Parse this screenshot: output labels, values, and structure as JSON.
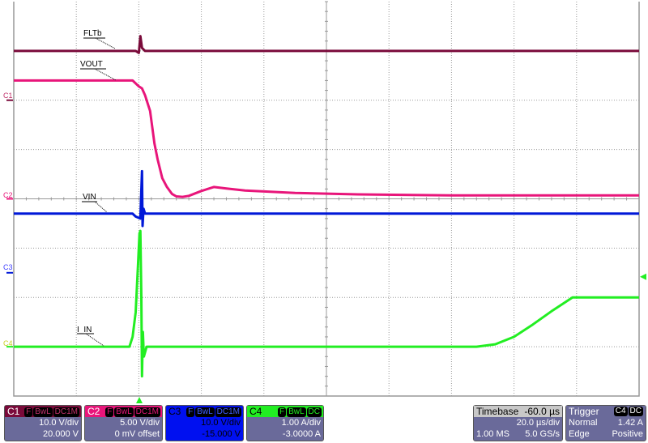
{
  "chart_data": {
    "type": "line",
    "title": "",
    "xlabel": "",
    "ylabel": "",
    "x_units": "µs",
    "xlim": [
      -40,
      160
    ],
    "grid": true,
    "divisions": {
      "horizontal": 10,
      "vertical": 8
    },
    "trace_labels": {
      "fltb": "FLTb",
      "vout": "VOUT",
      "vin": "VIN",
      "iin": "I_IN"
    },
    "series": [
      {
        "channel": "C1",
        "name": "FLTb",
        "color": "#7a0a3a",
        "scale_per_div": 10,
        "offset": 20,
        "x": [
          -40,
          -1,
          0,
          0.5,
          1,
          2,
          160
        ],
        "y": [
          10,
          10,
          9.6,
          13,
          10.6,
          10,
          10
        ]
      },
      {
        "channel": "C2",
        "name": "VOUT",
        "color": "#e8157a",
        "scale_per_div": 5,
        "offset": 0,
        "x": [
          -40,
          -2,
          0,
          1,
          2,
          3.6,
          5,
          6,
          7.5,
          9,
          10.6,
          12,
          14,
          16,
          20,
          24,
          28,
          34,
          50,
          70,
          100,
          160
        ],
        "y": [
          12,
          12,
          11.4,
          11.2,
          10.5,
          8.9,
          5.6,
          4,
          2.1,
          1.2,
          0.5,
          0.25,
          0.2,
          0.3,
          0.8,
          1.2,
          1.05,
          0.85,
          0.6,
          0.45,
          0.35,
          0.35
        ]
      },
      {
        "channel": "C3",
        "name": "VIN",
        "color": "#0018d8",
        "scale_per_div": 10,
        "offset": -15,
        "x": [
          -40,
          -2,
          -1,
          0.5,
          1,
          1.2,
          1.5,
          2,
          160
        ],
        "y": [
          12,
          12,
          11.4,
          11,
          20.6,
          9.5,
          13,
          12,
          12
        ]
      },
      {
        "channel": "C4",
        "name": "I_IN",
        "color": "#22ee22",
        "scale_per_div": 1,
        "offset": -3,
        "x": [
          -40,
          -3,
          -2,
          -1,
          -0.3,
          0.2,
          0.5,
          0.8,
          1,
          1.3,
          1.6,
          2.5,
          108,
          114,
          120,
          126,
          132,
          138.7,
          160
        ],
        "y": [
          0,
          0,
          0.2,
          0.7,
          1.6,
          2.3,
          2.35,
          1.0,
          -0.6,
          0.3,
          -0.2,
          0,
          0,
          0.05,
          0.2,
          0.45,
          0.72,
          1.0,
          1.0
        ]
      }
    ],
    "trigger_level": 1.42
  },
  "panels": {
    "c1": {
      "name": "C1",
      "tags": [
        "F",
        "BwL",
        "DC1M"
      ],
      "scale": "10.0 V/div",
      "offset": "20.000 V",
      "color": "#7a0a3a"
    },
    "c2": {
      "name": "C2",
      "tags": [
        "F",
        "BwL",
        "DC1M"
      ],
      "scale": "5.00 V/div",
      "offset": "0 mV offset",
      "color": "#e8157a"
    },
    "c3": {
      "name": "C3",
      "tags": [
        "F",
        "BwL",
        "DC1M"
      ],
      "scale": "10.0 V/div",
      "offset": "-15.000 V",
      "color": "#0010f0"
    },
    "c4": {
      "name": "C4",
      "tags": [
        "F",
        "BwL",
        "DC"
      ],
      "scale": "1.00 A/div",
      "offset": "-3.0000 A",
      "color": "#22ee22"
    },
    "timebase": {
      "label": "Timebase",
      "delay": "-60.0 µs",
      "scale": "20.0 µs/div",
      "samples": "1.00 MS",
      "rate": "5.0 GS/s"
    },
    "trigger": {
      "label": "Trigger",
      "source": "C4",
      "coupling": "DC",
      "mode": "Normal",
      "level": "1.42 A",
      "type": "Edge",
      "slope": "Positive"
    }
  }
}
